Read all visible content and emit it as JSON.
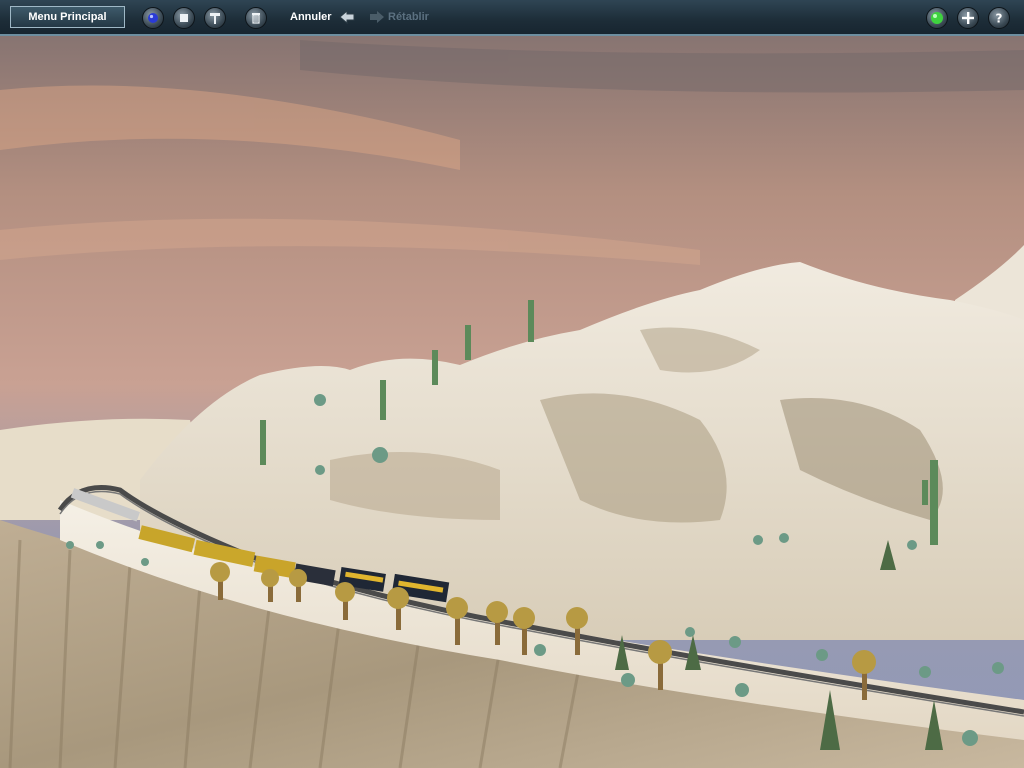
{
  "toolbar": {
    "menu_label": "Menu Principal",
    "undo_label": "Annuler",
    "redo_label": "Rétablir",
    "colors": {
      "bar": "#1d2d38",
      "border": "#6d8ea0",
      "undo_text": "#ffffff",
      "redo_text": "#5b7080",
      "status_green": "#3fd23f"
    },
    "icons": [
      "record-icon",
      "stop-icon",
      "track-tool-icon",
      "trash-icon",
      "status-light-icon",
      "zoom-in-icon",
      "help-icon"
    ]
  }
}
